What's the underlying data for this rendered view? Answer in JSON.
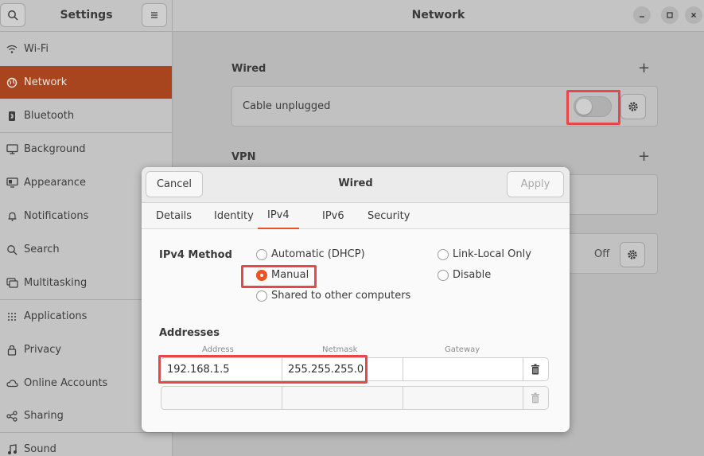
{
  "sidebar": {
    "title": "Settings",
    "items": [
      {
        "label": "Wi-Fi",
        "icon": "wifi-icon"
      },
      {
        "label": "Network",
        "icon": "globe-icon"
      },
      {
        "label": "Bluetooth",
        "icon": "bluetooth-icon"
      },
      {
        "label": "Background",
        "icon": "monitor-icon"
      },
      {
        "label": "Appearance",
        "icon": "appearance-icon"
      },
      {
        "label": "Notifications",
        "icon": "bell-icon"
      },
      {
        "label": "Search",
        "icon": "search-icon"
      },
      {
        "label": "Multitasking",
        "icon": "multitasking-icon"
      },
      {
        "label": "Applications",
        "icon": "grid-icon"
      },
      {
        "label": "Privacy",
        "icon": "lock-icon"
      },
      {
        "label": "Online Accounts",
        "icon": "cloud-icon"
      },
      {
        "label": "Sharing",
        "icon": "share-icon"
      },
      {
        "label": "Sound",
        "icon": "music-note-icon"
      }
    ],
    "active": "Network"
  },
  "main": {
    "title": "Network",
    "wired": {
      "title": "Wired",
      "status": "Cable unplugged",
      "enabled": false
    },
    "vpn": {
      "title": "VPN"
    },
    "proxy": {
      "status": "Off"
    }
  },
  "dialog": {
    "title": "Wired",
    "cancel": "Cancel",
    "apply": "Apply",
    "tabs": [
      "Details",
      "Identity",
      "IPv4",
      "IPv6",
      "Security"
    ],
    "active_tab": "IPv4",
    "ipv4_method_label": "IPv4 Method",
    "methods": {
      "automatic": "Automatic (DHCP)",
      "manual": "Manual",
      "shared": "Shared to other computers",
      "link_local": "Link-Local Only",
      "disable": "Disable"
    },
    "selected_method": "Manual",
    "addresses_label": "Addresses",
    "columns": [
      "Address",
      "Netmask",
      "Gateway"
    ],
    "rows": [
      {
        "address": "192.168.1.5",
        "netmask": "255.255.255.0",
        "gateway": ""
      },
      {
        "address": "",
        "netmask": "",
        "gateway": ""
      }
    ]
  },
  "colors": {
    "accent": "#e95420",
    "sidebar_active": "#a8451e",
    "highlight": "#e8464b"
  }
}
